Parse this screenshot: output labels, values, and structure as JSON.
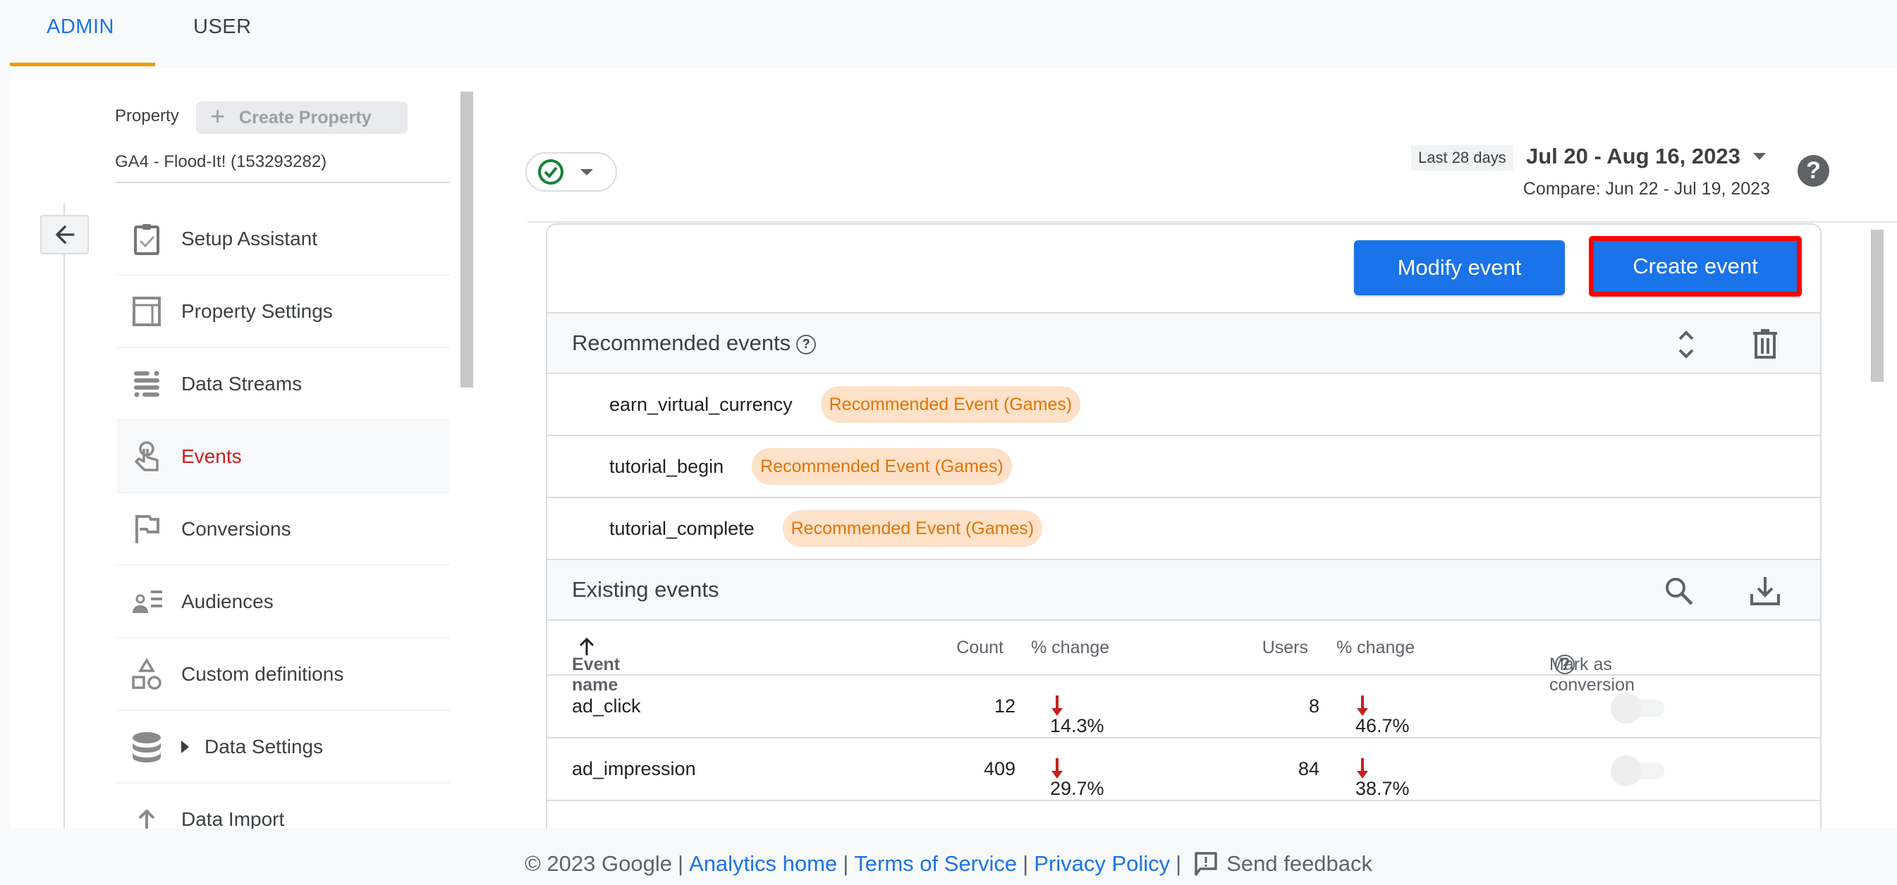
{
  "tabs": [
    {
      "label": "ADMIN",
      "active": true
    },
    {
      "label": "USER",
      "active": false
    }
  ],
  "sidebar": {
    "property_label": "Property",
    "create_property_label": "Create Property",
    "property_name": "GA4 - Flood-It! (153293282)",
    "back_icon": "arrow-back-icon",
    "items": [
      {
        "label": "Setup Assistant",
        "icon": "clipboard-check-icon",
        "active": false
      },
      {
        "label": "Property Settings",
        "icon": "property-layout-icon",
        "active": false
      },
      {
        "label": "Data Streams",
        "icon": "data-streams-icon",
        "active": false
      },
      {
        "label": "Events",
        "icon": "touch-icon",
        "active": true
      },
      {
        "label": "Conversions",
        "icon": "flag-icon",
        "active": false
      },
      {
        "label": "Audiences",
        "icon": "audience-icon",
        "active": false
      },
      {
        "label": "Custom definitions",
        "icon": "shapes-icon",
        "active": false
      },
      {
        "label": "Data Settings",
        "icon": "database-icon",
        "active": false,
        "expandable": true
      },
      {
        "label": "Data Import",
        "icon": "upload-icon",
        "active": false
      }
    ]
  },
  "header": {
    "status_icon": "check-circle-icon",
    "range_badge": "Last 28 days",
    "date_range": "Jul 20 - Aug 16, 2023",
    "compare": "Compare: Jun 22 - Jul 19, 2023",
    "help_label": "?"
  },
  "actions": {
    "modify_event": "Modify event",
    "create_event": "Create event"
  },
  "recommended": {
    "title": "Recommended events",
    "help": "?",
    "events": [
      {
        "name": "earn_virtual_currency",
        "badge": "Recommended Event (Games)"
      },
      {
        "name": "tutorial_begin",
        "badge": "Recommended Event (Games)"
      },
      {
        "name": "tutorial_complete",
        "badge": "Recommended Event (Games)"
      }
    ]
  },
  "existing": {
    "title": "Existing events",
    "columns": {
      "event_name": "Event name",
      "count": "Count",
      "count_change": "% change",
      "users": "Users",
      "users_change": "% change",
      "mark_conversion": "Mark as conversion",
      "help": "?"
    },
    "rows": [
      {
        "name": "ad_click",
        "count": "12",
        "count_change": "14.3%",
        "users": "8",
        "users_change": "46.7%",
        "conversion": false
      },
      {
        "name": "ad_impression",
        "count": "409",
        "count_change": "29.7%",
        "users": "84",
        "users_change": "38.7%",
        "conversion": false
      }
    ]
  },
  "footer": {
    "copyright": "© 2023 Google",
    "links": [
      "Analytics home",
      "Terms of Service",
      "Privacy Policy"
    ],
    "feedback": "Send feedback"
  },
  "colors": {
    "accent": "#1a73e8",
    "active_nav": "#c5221f",
    "tab_underline": "#f29900",
    "decrease": "#c5221f",
    "badge_bg": "#fde1c8",
    "badge_text": "#e37400",
    "highlight_border": "#ff0000"
  }
}
